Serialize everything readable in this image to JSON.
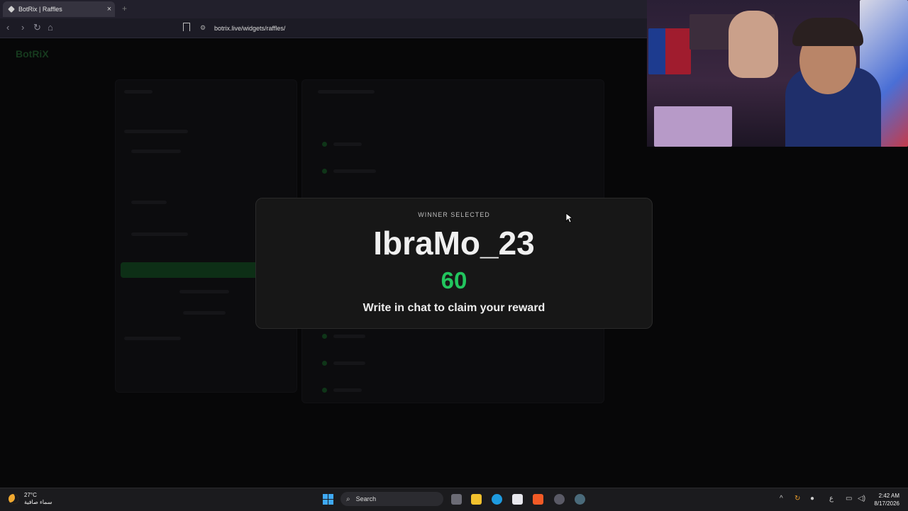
{
  "browser": {
    "tab_title": "BotRix | Raffles",
    "close_glyph": "×",
    "new_tab_glyph": "+",
    "url": "botrix.live/widgets/raffles/"
  },
  "page": {
    "logo_text": "BotRiX"
  },
  "winner_modal": {
    "label": "WINNER SELECTED",
    "winner_name": "IbraMo_23",
    "countdown": "60",
    "message": "Write in chat to claim your reward",
    "accent_color": "#22c55e"
  },
  "taskbar": {
    "temperature": "27°C",
    "weather_desc": "سماء صافية",
    "search_placeholder": "Search",
    "language": "ع",
    "time": "2:42 AM",
    "date": "8/17/2026"
  }
}
